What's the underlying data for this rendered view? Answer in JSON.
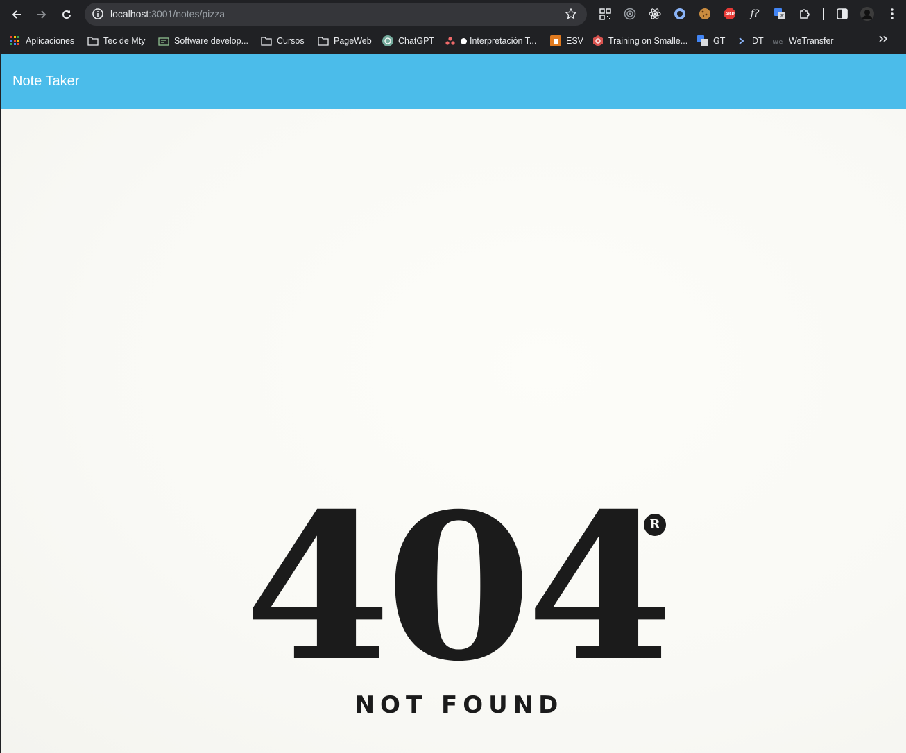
{
  "browser": {
    "url_host": "localhost",
    "url_rest": ":3001/notes/pizza",
    "extensions": [
      "qr-code-icon",
      "target-icon",
      "react-icon",
      "circle-ext-icon",
      "cookie-icon",
      "adblock-icon",
      "function-icon",
      "translate-icon",
      "puzzle-icon",
      "sidepanel-icon",
      "profile-avatar",
      "menu-icon"
    ],
    "adblock_label": "ABP",
    "function_label": "f?"
  },
  "bookmarks": {
    "items": [
      {
        "label": "Aplicaciones",
        "icon": "apps-grid-icon"
      },
      {
        "label": "Tec de Mty",
        "icon": "folder-icon"
      },
      {
        "label": "Software develop...",
        "icon": "stackoverflow-icon"
      },
      {
        "label": "Cursos",
        "icon": "folder-icon"
      },
      {
        "label": "PageWeb",
        "icon": "folder-icon"
      },
      {
        "label": "ChatGPT",
        "icon": "chatgpt-icon"
      },
      {
        "label": "Interpretación T...",
        "icon": "asana-icon"
      },
      {
        "label": "ESV",
        "icon": "esv-icon"
      },
      {
        "label": "Training on Smalle...",
        "icon": "training-icon"
      },
      {
        "label": "GT",
        "icon": "translate-icon"
      },
      {
        "label": "DT",
        "icon": "dt-icon"
      },
      {
        "label": "WeTransfer",
        "icon": "wetransfer-icon"
      }
    ]
  },
  "app": {
    "title": "Note Taker"
  },
  "error": {
    "code": "404",
    "message": "NOT FOUND",
    "mark": "R"
  },
  "colors": {
    "header": "#4bbcea",
    "page_bg": "#fbfbf7",
    "text_dark": "#1b1b1b"
  }
}
